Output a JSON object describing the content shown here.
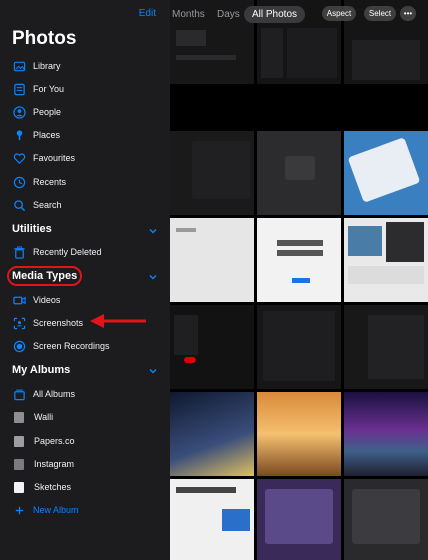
{
  "sidebar": {
    "edit_label": "Edit",
    "title": "Photos",
    "library_items": [
      {
        "label": "Library",
        "icon": "photo-library-icon"
      },
      {
        "label": "For You",
        "icon": "for-you-icon"
      },
      {
        "label": "People",
        "icon": "people-icon"
      },
      {
        "label": "Places",
        "icon": "places-icon"
      },
      {
        "label": "Favourites",
        "icon": "heart-icon"
      },
      {
        "label": "Recents",
        "icon": "clock-icon"
      },
      {
        "label": "Search",
        "icon": "search-icon"
      }
    ],
    "utilities": {
      "header": "Utilities",
      "items": [
        {
          "label": "Recently Deleted",
          "icon": "trash-icon"
        }
      ]
    },
    "media_types": {
      "header": "Media Types",
      "items": [
        {
          "label": "Videos",
          "icon": "video-icon"
        },
        {
          "label": "Screenshots",
          "icon": "screenshot-icon"
        },
        {
          "label": "Screen Recordings",
          "icon": "screen-record-icon"
        }
      ]
    },
    "my_albums": {
      "header": "My Albums",
      "items": [
        {
          "label": "All Albums",
          "icon": "albums-icon"
        },
        {
          "label": "Walli"
        },
        {
          "label": "Papers.co"
        },
        {
          "label": "Instagram"
        },
        {
          "label": "Sketches"
        },
        {
          "label": "New Album",
          "icon": "plus-icon"
        }
      ]
    }
  },
  "toolbar": {
    "segments": [
      "Months",
      "Days",
      "All Photos"
    ],
    "active_segment": "All Photos",
    "aspect_label": "Aspect",
    "select_label": "Select",
    "more_label": "•••"
  },
  "colors": {
    "accent": "#0a84ff",
    "highlight": "#e0141c",
    "sidebar_bg": "#1c1c1e"
  }
}
